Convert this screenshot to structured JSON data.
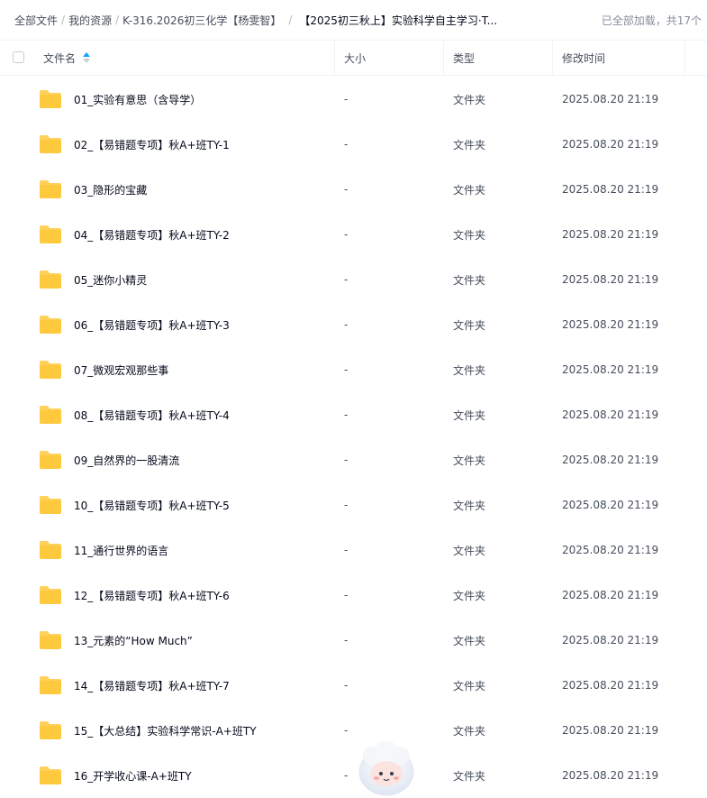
{
  "breadcrumb": {
    "items": [
      {
        "label": "全部文件"
      },
      {
        "label": "我的资源"
      },
      {
        "label": "K-316.2026初三化学【杨雯智】"
      },
      {
        "label": "【2025初三秋上】实验科学自主学习·T..."
      }
    ],
    "separator": "/"
  },
  "status": {
    "text": "已全部加载，共17个"
  },
  "table": {
    "columns": {
      "name": "文件名",
      "size": "大小",
      "type": "类型",
      "mtime": "修改时间"
    },
    "rows": [
      {
        "name": "01_实验有意思（含导学）",
        "size": "-",
        "type": "文件夹",
        "mtime": "2025.08.20 21:19"
      },
      {
        "name": "02_【易错题专项】秋A+班TY-1",
        "size": "-",
        "type": "文件夹",
        "mtime": "2025.08.20 21:19"
      },
      {
        "name": "03_隐形的宝藏",
        "size": "-",
        "type": "文件夹",
        "mtime": "2025.08.20 21:19"
      },
      {
        "name": "04_【易错题专项】秋A+班TY-2",
        "size": "-",
        "type": "文件夹",
        "mtime": "2025.08.20 21:19"
      },
      {
        "name": "05_迷你小精灵",
        "size": "-",
        "type": "文件夹",
        "mtime": "2025.08.20 21:19"
      },
      {
        "name": "06_【易错题专项】秋A+班TY-3",
        "size": "-",
        "type": "文件夹",
        "mtime": "2025.08.20 21:19"
      },
      {
        "name": "07_微观宏观那些事",
        "size": "-",
        "type": "文件夹",
        "mtime": "2025.08.20 21:19"
      },
      {
        "name": "08_【易错题专项】秋A+班TY-4",
        "size": "-",
        "type": "文件夹",
        "mtime": "2025.08.20 21:19"
      },
      {
        "name": "09_自然界的一股清流",
        "size": "-",
        "type": "文件夹",
        "mtime": "2025.08.20 21:19"
      },
      {
        "name": "10_【易错题专项】秋A+班TY-5",
        "size": "-",
        "type": "文件夹",
        "mtime": "2025.08.20 21:19"
      },
      {
        "name": "11_通行世界的语言",
        "size": "-",
        "type": "文件夹",
        "mtime": "2025.08.20 21:19"
      },
      {
        "name": "12_【易错题专项】秋A+班TY-6",
        "size": "-",
        "type": "文件夹",
        "mtime": "2025.08.20 21:19"
      },
      {
        "name": "13_元素的“How Much”",
        "size": "-",
        "type": "文件夹",
        "mtime": "2025.08.20 21:19"
      },
      {
        "name": "14_【易错题专项】秋A+班TY-7",
        "size": "-",
        "type": "文件夹",
        "mtime": "2025.08.20 21:19"
      },
      {
        "name": "15_【大总结】实验科学常识-A+班TY",
        "size": "-",
        "type": "文件夹",
        "mtime": "2025.08.20 21:19"
      },
      {
        "name": "16_开学收心课-A+班TY",
        "size": "-",
        "type": "文件夹",
        "mtime": "2025.08.20 21:19"
      }
    ]
  },
  "icons": {
    "folder": "folder-icon",
    "sort": "sort-ascending-icon",
    "mascot": "mascot-icon"
  },
  "colors": {
    "folder": "#ffc93d",
    "sort_active": "#06a7ff"
  }
}
